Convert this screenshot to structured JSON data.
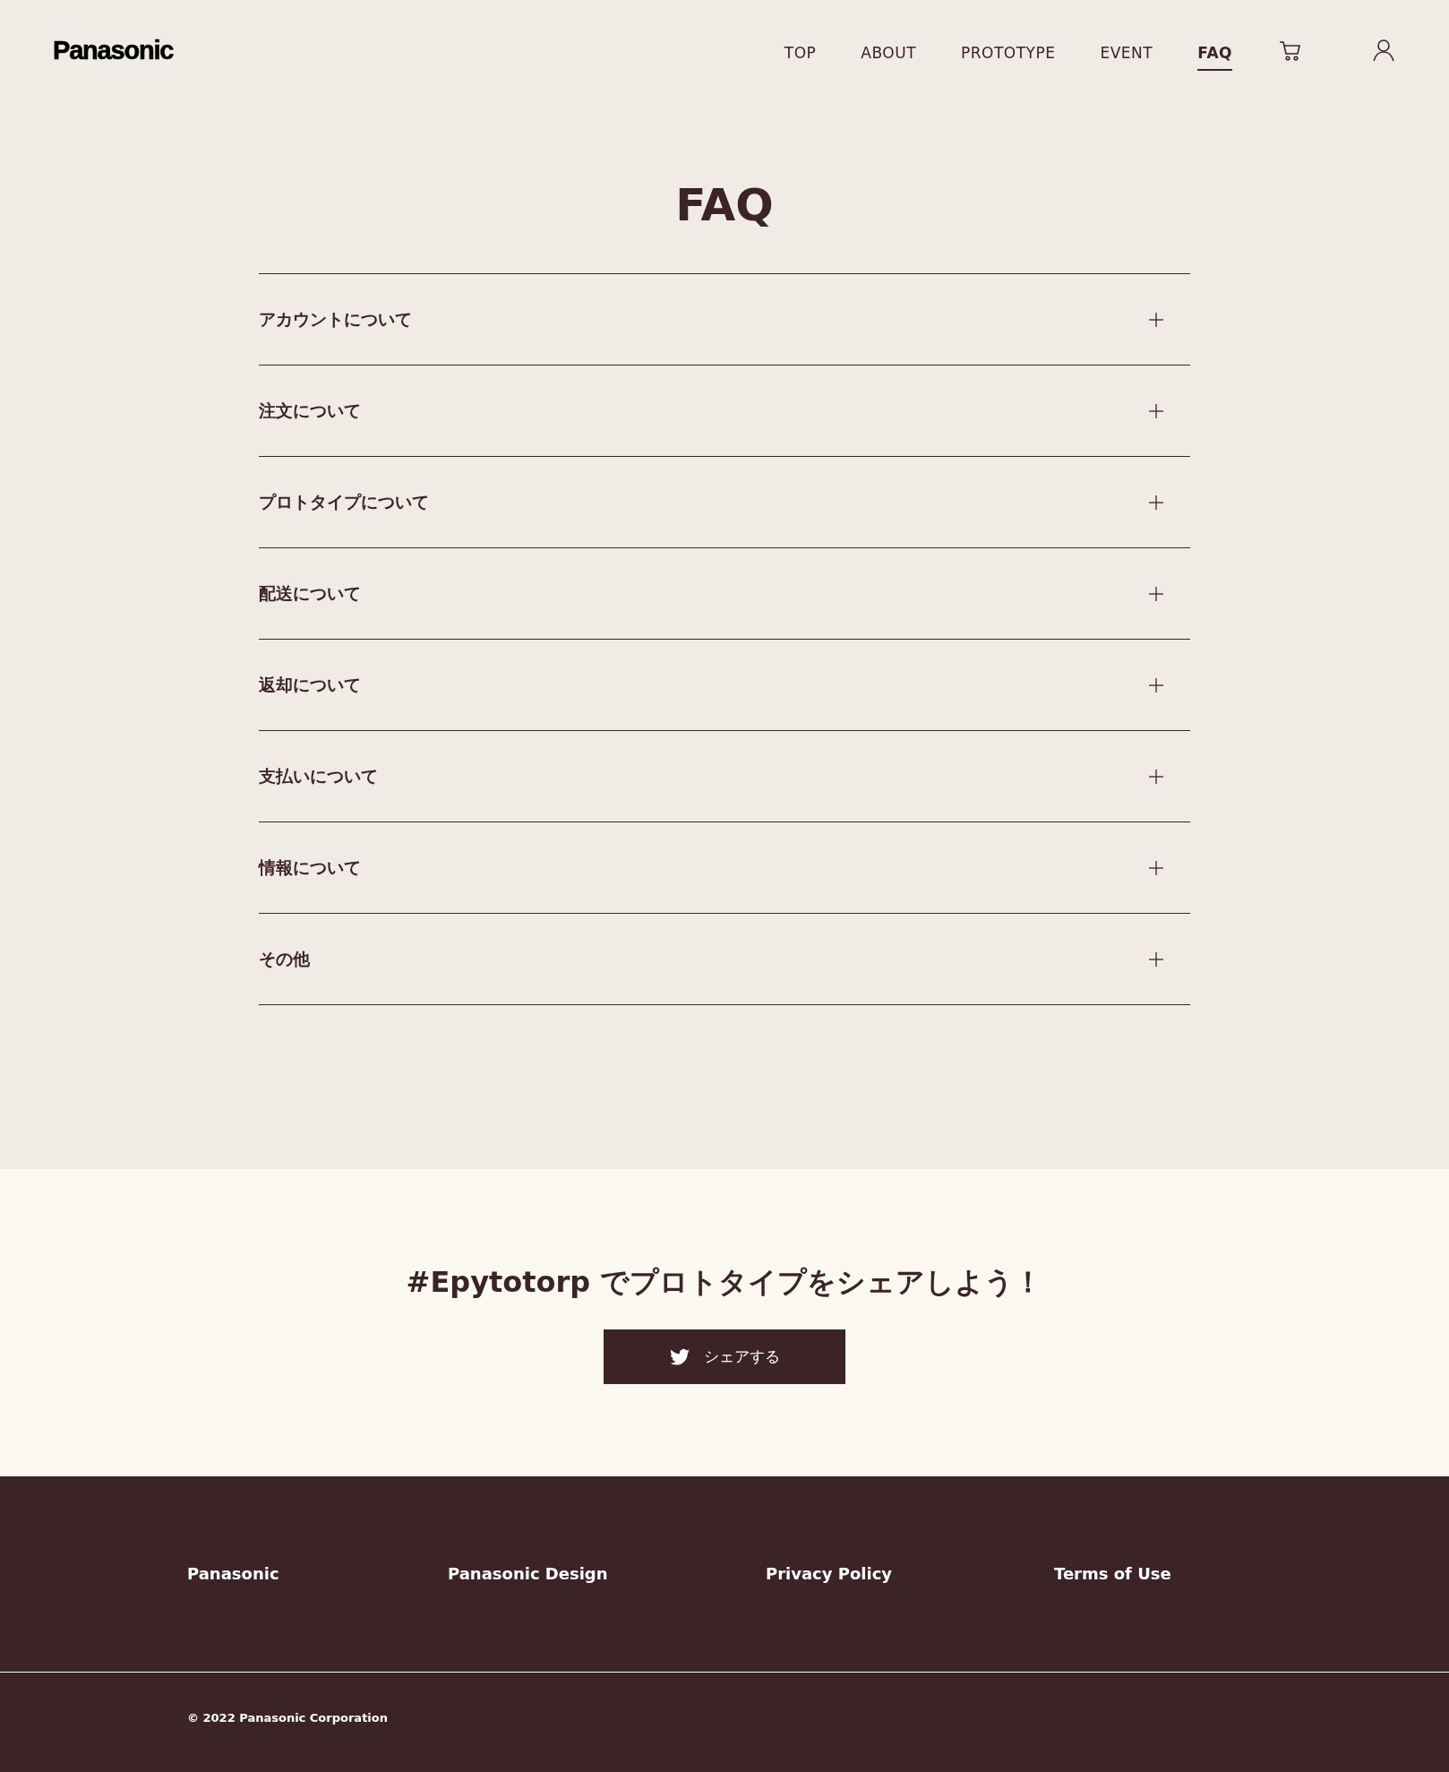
{
  "header": {
    "logo": "Panasonic",
    "nav": [
      {
        "label": "TOP",
        "selected": false
      },
      {
        "label": "ABOUT",
        "selected": false
      },
      {
        "label": "PROTOTYPE",
        "selected": false
      },
      {
        "label": "EVENT",
        "selected": false
      },
      {
        "label": "FAQ",
        "selected": true
      }
    ]
  },
  "title": "FAQ",
  "faq": [
    {
      "label": "アカウントについて",
      "expanded": false
    },
    {
      "label": "注文について",
      "expanded": false
    },
    {
      "label": "プロトタイプについて",
      "expanded": false
    },
    {
      "label": "配送について",
      "expanded": false
    },
    {
      "label": "返却について",
      "expanded": false
    },
    {
      "label": "支払いについて",
      "expanded": false
    },
    {
      "label": "情報について",
      "expanded": false
    },
    {
      "label": "その他",
      "expanded": false
    }
  ],
  "share": {
    "heading": "#Epytotorp でプロトタイプをシェアしよう！",
    "button": "シェアする"
  },
  "footer": {
    "links": [
      "Panasonic",
      "Panasonic Design",
      "Privacy Policy",
      "Terms of Use"
    ],
    "copyright": "© 2022 Panasonic Corporation"
  }
}
